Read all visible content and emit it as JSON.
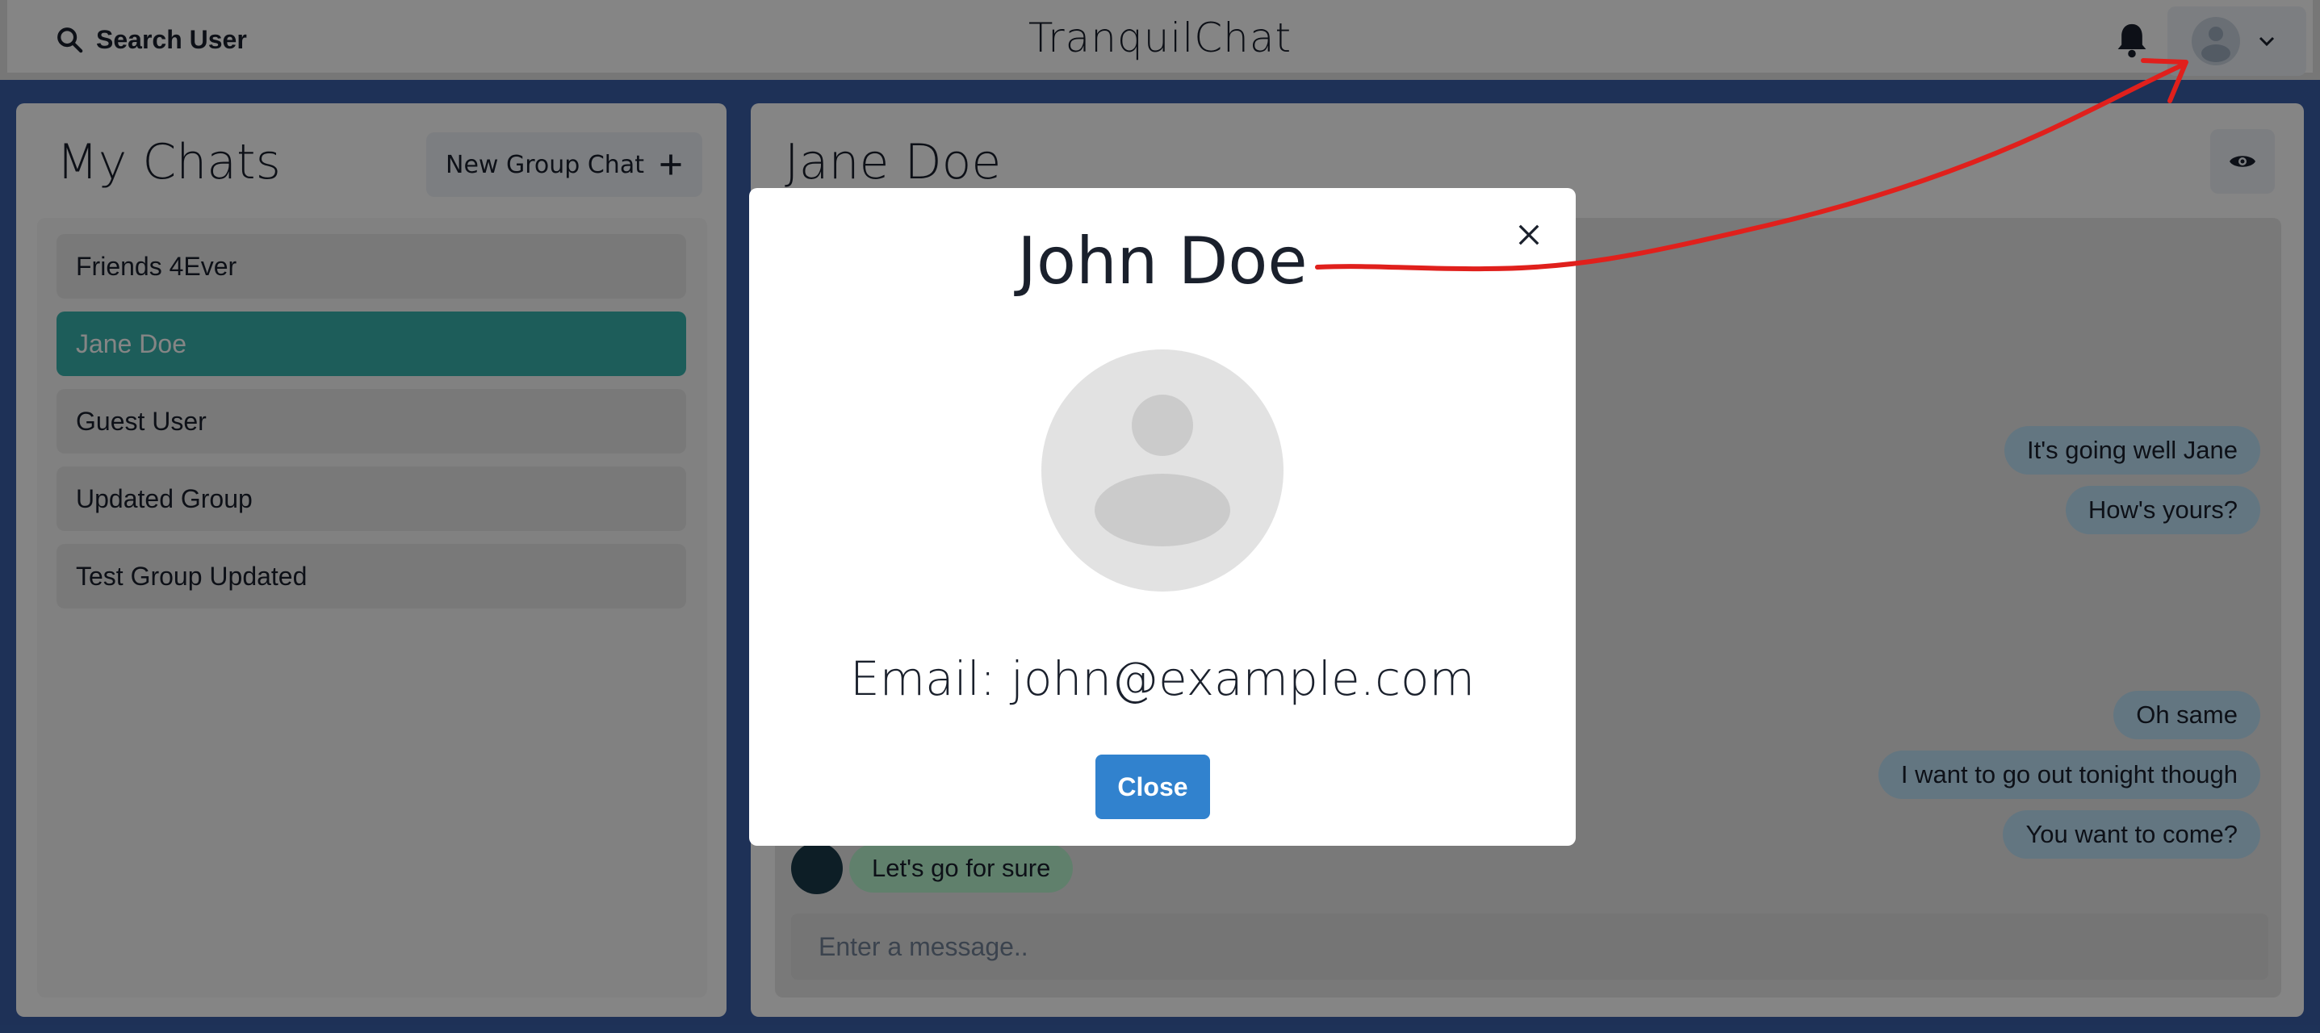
{
  "topbar": {
    "search_label": "Search User",
    "app_title": "TranquilChat",
    "icons": {
      "search": "search-icon",
      "bell": "bell-icon",
      "avatar": "avatar-icon",
      "chevron": "chevron-down-icon"
    }
  },
  "chats_panel": {
    "title": "My Chats",
    "new_group_label": "New Group Chat",
    "items": [
      {
        "label": "Friends 4Ever",
        "active": false
      },
      {
        "label": "Jane Doe",
        "active": true
      },
      {
        "label": "Guest User",
        "active": false
      },
      {
        "label": "Updated Group",
        "active": false
      },
      {
        "label": "Test Group Updated",
        "active": false
      }
    ]
  },
  "chat_panel": {
    "title": "Jane Doe",
    "messages": [
      {
        "text": "It's going well Jane",
        "type": "sent"
      },
      {
        "text": "How's yours?",
        "type": "sent"
      },
      {
        "text": "Oh same",
        "type": "sent"
      },
      {
        "text": "I want to go out tonight though",
        "type": "sent"
      },
      {
        "text": "You want to come?",
        "type": "sent"
      },
      {
        "text": "Let's go for sure",
        "type": "received"
      }
    ],
    "input_placeholder": "Enter a message.."
  },
  "modal": {
    "title": "John Doe",
    "email_text": "Email: john@example.com",
    "close_button_label": "Close"
  },
  "colors": {
    "background": "#3a5fa8",
    "active_chat": "#38b2ac",
    "sent_bubble": "#bee3f8",
    "received_bubble": "#b9f5d0",
    "primary_button": "#3182ce",
    "annotation": "#e0201c"
  }
}
